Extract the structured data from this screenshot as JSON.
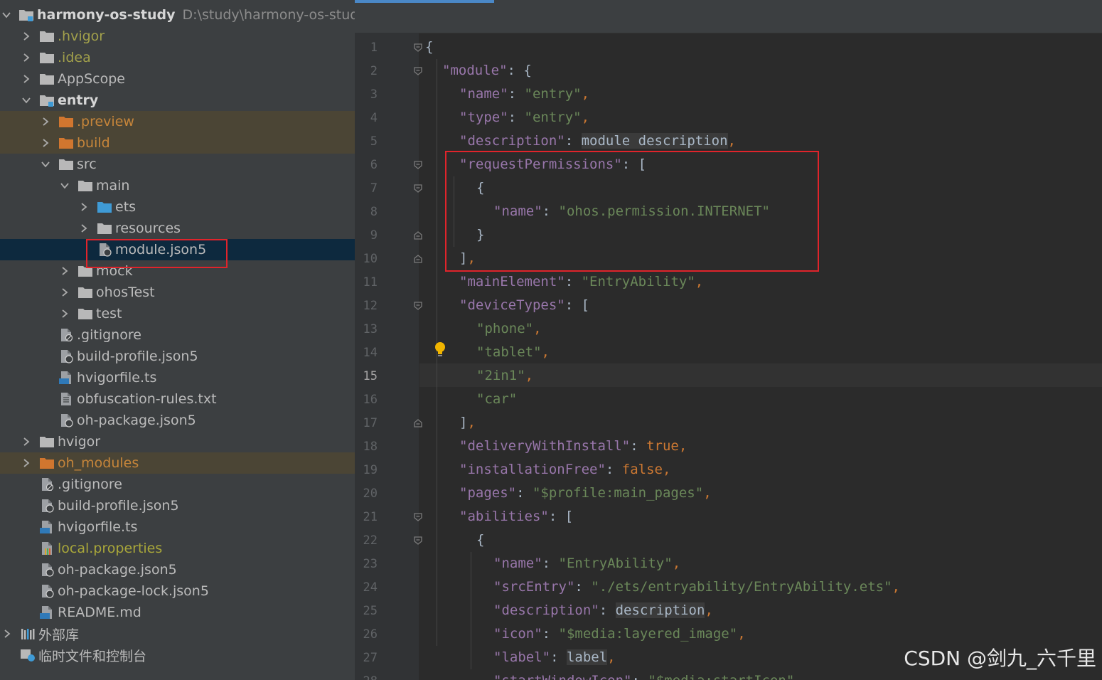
{
  "project": {
    "name": "harmony-os-study",
    "path": "D:\\study\\harmony-os-study"
  },
  "tree": [
    {
      "label": "harmony-os-study",
      "indent": 0,
      "arrow": "down",
      "icon": "project-folder-icon",
      "style": "bold",
      "extra": "D:\\study\\harmony-os-study"
    },
    {
      "label": ".hvigor",
      "indent": 1,
      "arrow": "right",
      "icon": "folder-icon",
      "style": "yellow"
    },
    {
      "label": ".idea",
      "indent": 1,
      "arrow": "right",
      "icon": "folder-icon",
      "style": "yellow"
    },
    {
      "label": "AppScope",
      "indent": 1,
      "arrow": "right",
      "icon": "folder-icon",
      "style": "normal"
    },
    {
      "label": "entry",
      "indent": 1,
      "arrow": "down",
      "icon": "module-folder-icon",
      "style": "bold"
    },
    {
      "label": ".preview",
      "indent": 2,
      "arrow": "right",
      "icon": "orange-folder-icon",
      "style": "orange",
      "row": "ignored"
    },
    {
      "label": "build",
      "indent": 2,
      "arrow": "right",
      "icon": "orange-folder-icon",
      "style": "orange",
      "row": "ignored"
    },
    {
      "label": "src",
      "indent": 2,
      "arrow": "down",
      "icon": "folder-icon",
      "style": "normal"
    },
    {
      "label": "main",
      "indent": 3,
      "arrow": "down",
      "icon": "folder-icon",
      "style": "normal"
    },
    {
      "label": "ets",
      "indent": 4,
      "arrow": "right",
      "icon": "blue-folder-icon",
      "style": "normal"
    },
    {
      "label": "resources",
      "indent": 4,
      "arrow": "right",
      "icon": "folder-icon",
      "style": "normal"
    },
    {
      "label": "module.json5",
      "indent": 4,
      "arrow": "none",
      "icon": "json5-file-icon",
      "style": "normal",
      "row": "selected"
    },
    {
      "label": "mock",
      "indent": 3,
      "arrow": "right",
      "icon": "folder-icon",
      "style": "normal"
    },
    {
      "label": "ohosTest",
      "indent": 3,
      "arrow": "right",
      "icon": "folder-icon",
      "style": "normal"
    },
    {
      "label": "test",
      "indent": 3,
      "arrow": "right",
      "icon": "folder-icon",
      "style": "normal"
    },
    {
      "label": ".gitignore",
      "indent": 2,
      "arrow": "none",
      "icon": "gitignore-file-icon",
      "style": "normal"
    },
    {
      "label": "build-profile.json5",
      "indent": 2,
      "arrow": "none",
      "icon": "json5-file-icon",
      "style": "normal"
    },
    {
      "label": "hvigorfile.ts",
      "indent": 2,
      "arrow": "none",
      "icon": "ts-file-icon",
      "style": "normal"
    },
    {
      "label": "obfuscation-rules.txt",
      "indent": 2,
      "arrow": "none",
      "icon": "text-file-icon",
      "style": "normal"
    },
    {
      "label": "oh-package.json5",
      "indent": 2,
      "arrow": "none",
      "icon": "json5-file-icon",
      "style": "normal"
    },
    {
      "label": "hvigor",
      "indent": 1,
      "arrow": "right",
      "icon": "folder-icon",
      "style": "normal"
    },
    {
      "label": "oh_modules",
      "indent": 1,
      "arrow": "right",
      "icon": "orange-folder-icon",
      "style": "orange",
      "row": "ignored"
    },
    {
      "label": ".gitignore",
      "indent": 1,
      "arrow": "none",
      "icon": "gitignore-file-icon",
      "style": "normal"
    },
    {
      "label": "build-profile.json5",
      "indent": 1,
      "arrow": "none",
      "icon": "json5-file-icon",
      "style": "normal"
    },
    {
      "label": "hvigorfile.ts",
      "indent": 1,
      "arrow": "none",
      "icon": "ts-file-icon",
      "style": "normal"
    },
    {
      "label": "local.properties",
      "indent": 1,
      "arrow": "none",
      "icon": "properties-file-icon",
      "style": "olive"
    },
    {
      "label": "oh-package.json5",
      "indent": 1,
      "arrow": "none",
      "icon": "json5-file-icon",
      "style": "normal"
    },
    {
      "label": "oh-package-lock.json5",
      "indent": 1,
      "arrow": "none",
      "icon": "json5-file-icon",
      "style": "normal"
    },
    {
      "label": "README.md",
      "indent": 1,
      "arrow": "none",
      "icon": "md-file-icon",
      "style": "normal"
    },
    {
      "label": "外部库",
      "indent": 0,
      "arrow": "right",
      "icon": "library-icon",
      "style": "normal"
    },
    {
      "label": "临时文件和控制台",
      "indent": 0,
      "arrow": "none",
      "icon": "scratch-console-icon",
      "style": "normal"
    }
  ],
  "editor": {
    "current_line": 15,
    "lines": [
      {
        "n": 1,
        "ind": 0,
        "fold": "open",
        "t": [
          [
            "b",
            "{"
          ]
        ]
      },
      {
        "n": 2,
        "ind": 1,
        "fold": "open",
        "t": [
          [
            "k",
            "\"module\""
          ],
          [
            "b",
            ": {"
          ]
        ]
      },
      {
        "n": 3,
        "ind": 2,
        "t": [
          [
            "k",
            "\"name\""
          ],
          [
            "b",
            ": "
          ],
          [
            "s",
            "\"entry\""
          ],
          [
            "p",
            ","
          ]
        ]
      },
      {
        "n": 4,
        "ind": 2,
        "t": [
          [
            "k",
            "\"type\""
          ],
          [
            "b",
            ": "
          ],
          [
            "s",
            "\"entry\""
          ],
          [
            "p",
            ","
          ]
        ]
      },
      {
        "n": 5,
        "ind": 2,
        "t": [
          [
            "k",
            "\"description\""
          ],
          [
            "b",
            ": "
          ],
          [
            "u",
            "module description"
          ],
          [
            "p",
            ","
          ]
        ]
      },
      {
        "n": 6,
        "ind": 2,
        "fold": "open",
        "t": [
          [
            "k",
            "\"requestPermissions\""
          ],
          [
            "b",
            ": ["
          ]
        ]
      },
      {
        "n": 7,
        "ind": 3,
        "fold": "open",
        "t": [
          [
            "b",
            "{"
          ]
        ]
      },
      {
        "n": 8,
        "ind": 4,
        "t": [
          [
            "k",
            "\"name\""
          ],
          [
            "b",
            ": "
          ],
          [
            "s",
            "\"ohos.permission.INTERNET\""
          ]
        ]
      },
      {
        "n": 9,
        "ind": 3,
        "fold": "close",
        "t": [
          [
            "b",
            "}"
          ]
        ]
      },
      {
        "n": 10,
        "ind": 2,
        "fold": "close",
        "t": [
          [
            "b",
            "]"
          ],
          [
            "p",
            ","
          ]
        ]
      },
      {
        "n": 11,
        "ind": 2,
        "t": [
          [
            "k",
            "\"mainElement\""
          ],
          [
            "b",
            ": "
          ],
          [
            "s",
            "\"EntryAbility\""
          ],
          [
            "p",
            ","
          ]
        ]
      },
      {
        "n": 12,
        "ind": 2,
        "fold": "open",
        "t": [
          [
            "k",
            "\"deviceTypes\""
          ],
          [
            "b",
            ": ["
          ]
        ]
      },
      {
        "n": 13,
        "ind": 3,
        "t": [
          [
            "s",
            "\"phone\""
          ],
          [
            "p",
            ","
          ]
        ]
      },
      {
        "n": 14,
        "ind": 3,
        "t": [
          [
            "s",
            "\"tablet\""
          ],
          [
            "p",
            ","
          ]
        ]
      },
      {
        "n": 15,
        "ind": 3,
        "t": [
          [
            "s",
            "\"2in1\""
          ],
          [
            "p",
            ","
          ]
        ]
      },
      {
        "n": 16,
        "ind": 3,
        "t": [
          [
            "s",
            "\"car\""
          ]
        ]
      },
      {
        "n": 17,
        "ind": 2,
        "fold": "close",
        "t": [
          [
            "b",
            "]"
          ],
          [
            "p",
            ","
          ]
        ]
      },
      {
        "n": 18,
        "ind": 2,
        "t": [
          [
            "k",
            "\"deliveryWithInstall\""
          ],
          [
            "b",
            ": "
          ],
          [
            "kw",
            "true"
          ],
          [
            "p",
            ","
          ]
        ]
      },
      {
        "n": 19,
        "ind": 2,
        "t": [
          [
            "k",
            "\"installationFree\""
          ],
          [
            "b",
            ": "
          ],
          [
            "kw",
            "false"
          ],
          [
            "p",
            ","
          ]
        ]
      },
      {
        "n": 20,
        "ind": 2,
        "t": [
          [
            "k",
            "\"pages\""
          ],
          [
            "b",
            ": "
          ],
          [
            "s",
            "\"$profile:main_pages\""
          ],
          [
            "p",
            ","
          ]
        ]
      },
      {
        "n": 21,
        "ind": 2,
        "fold": "open",
        "t": [
          [
            "k",
            "\"abilities\""
          ],
          [
            "b",
            ": ["
          ]
        ]
      },
      {
        "n": 22,
        "ind": 3,
        "fold": "open",
        "t": [
          [
            "b",
            "{"
          ]
        ]
      },
      {
        "n": 23,
        "ind": 4,
        "t": [
          [
            "k",
            "\"name\""
          ],
          [
            "b",
            ": "
          ],
          [
            "s",
            "\"EntryAbility\""
          ],
          [
            "p",
            ","
          ]
        ]
      },
      {
        "n": 24,
        "ind": 4,
        "t": [
          [
            "k",
            "\"srcEntry\""
          ],
          [
            "b",
            ": "
          ],
          [
            "s",
            "\"./ets/entryability/EntryAbility.ets\""
          ],
          [
            "p",
            ","
          ]
        ]
      },
      {
        "n": 25,
        "ind": 4,
        "t": [
          [
            "k",
            "\"description\""
          ],
          [
            "b",
            ": "
          ],
          [
            "u",
            "description"
          ],
          [
            "p",
            ","
          ]
        ]
      },
      {
        "n": 26,
        "ind": 4,
        "t": [
          [
            "k",
            "\"icon\""
          ],
          [
            "b",
            ": "
          ],
          [
            "s",
            "\"$media:layered_image\""
          ],
          [
            "p",
            ","
          ]
        ]
      },
      {
        "n": 27,
        "ind": 4,
        "t": [
          [
            "k",
            "\"label\""
          ],
          [
            "b",
            ": "
          ],
          [
            "u",
            "label"
          ],
          [
            "p",
            ","
          ]
        ]
      },
      {
        "n": 28,
        "ind": 4,
        "t": [
          [
            "k",
            "\"startWindowIcon\""
          ],
          [
            "b",
            ": "
          ],
          [
            "s",
            "\"$media:startIcon\""
          ],
          [
            "p",
            ","
          ]
        ]
      }
    ]
  },
  "watermark": "CSDN @剑九_六千里",
  "colors": {
    "key": "#9876aa",
    "string": "#6a8759",
    "keyword": "#cc7832",
    "highlight_box": "#e0242b",
    "selected_row": "#0d293e",
    "ignored_row": "#4b4535"
  }
}
